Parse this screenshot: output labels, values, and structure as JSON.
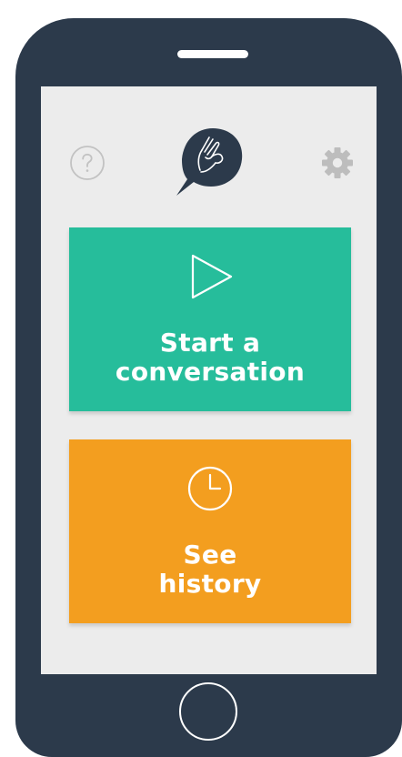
{
  "device": {
    "frame_color": "#2c3a4b",
    "screen_color": "#ececec"
  },
  "header": {
    "help_icon": "question-circle-icon",
    "logo_icon": "hand-speech-bubble-icon",
    "settings_icon": "gear-icon"
  },
  "actions": {
    "start": {
      "icon": "play-triangle-icon",
      "line1": "Start a",
      "line2": "conversation",
      "color": "#26bd9b"
    },
    "history": {
      "icon": "clock-icon",
      "line1": "See",
      "line2": "history",
      "color": "#f39e1f"
    }
  }
}
